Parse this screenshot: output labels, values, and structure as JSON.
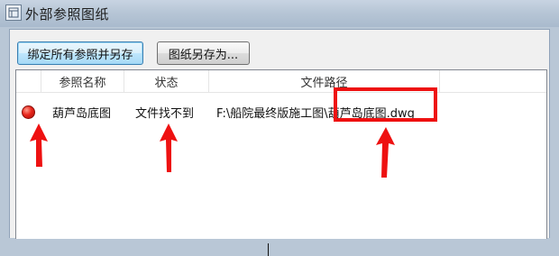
{
  "window": {
    "title": "外部参照图纸"
  },
  "toolbar": {
    "bind_save_all": "绑定所有参照并另存",
    "save_drawing_as": "图纸另存为..."
  },
  "table": {
    "columns": [
      "参照名称",
      "状态",
      "文件路径"
    ],
    "rows": [
      {
        "status_icon": "red-dot-icon",
        "name": "葫芦岛底图",
        "status": "文件找不到",
        "path": "F:\\船院最终版施工图\\葫芦岛底图.dwg"
      }
    ]
  },
  "colors": {
    "annotation_red": "#ee1111"
  }
}
